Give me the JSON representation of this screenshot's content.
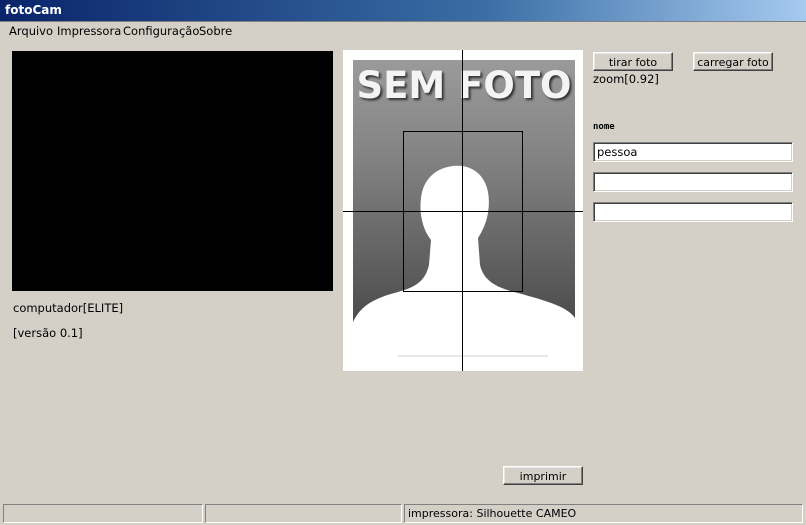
{
  "window": {
    "title": "fotoCam"
  },
  "menu": {
    "items": [
      "Arquivo",
      "Impressora",
      "Configuração",
      "Sobre"
    ]
  },
  "left": {
    "computer_label": "computador[ELITE]",
    "version_label": "[versão 0.1]"
  },
  "photo": {
    "placeholder_text": "SEM FOTO"
  },
  "right": {
    "take_photo_label": "tirar foto",
    "load_photo_label": "carregar foto",
    "zoom_label": "zoom[0.92]",
    "name_field_label": "nome",
    "field1_value": "pessoa",
    "field2_value": "",
    "field3_value": ""
  },
  "print_button_label": "imprimir",
  "status": {
    "panel1": "",
    "panel2": "",
    "panel3": "impressora: Silhouette CAMEO"
  },
  "colors": {
    "window_bg": "#d4d0c8",
    "titlebar": "#0a246a",
    "camera_bg": "#000000"
  }
}
